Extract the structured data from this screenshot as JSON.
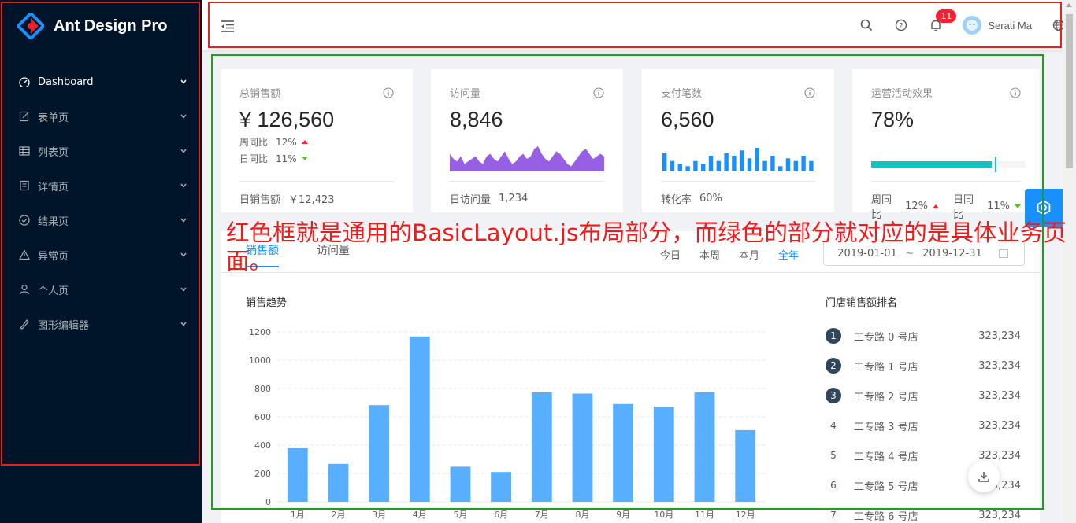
{
  "app": {
    "name": "Ant Design Pro"
  },
  "sidebar": {
    "items": [
      {
        "label": "Dashboard",
        "icon": "dashboard-icon",
        "active": true
      },
      {
        "label": "表单页",
        "icon": "form-icon"
      },
      {
        "label": "列表页",
        "icon": "table-icon"
      },
      {
        "label": "详情页",
        "icon": "profile-icon"
      },
      {
        "label": "结果页",
        "icon": "check-circle-icon"
      },
      {
        "label": "异常页",
        "icon": "warning-icon"
      },
      {
        "label": "个人页",
        "icon": "user-icon"
      },
      {
        "label": "图形编辑器",
        "icon": "highlight-icon"
      }
    ]
  },
  "header": {
    "notification_count": "11",
    "user_name": "Serati Ma"
  },
  "cards": {
    "sales": {
      "title": "总销售额",
      "value": "¥ 126,560",
      "week_label": "周同比",
      "week_value": "12%",
      "day_label": "日同比",
      "day_value": "11%",
      "footer_label": "日销售额",
      "footer_value": "￥12,423"
    },
    "visits": {
      "title": "访问量",
      "value": "8,846",
      "footer_label": "日访问量",
      "footer_value": "1,234"
    },
    "payments": {
      "title": "支付笔数",
      "value": "6,560",
      "footer_label": "转化率",
      "footer_value": "60%"
    },
    "operation": {
      "title": "运营活动效果",
      "value": "78%",
      "progress": 0.78,
      "target": 0.8,
      "week_label": "周同比",
      "week_value": "12%",
      "day_label": "日同比",
      "day_value": "11%"
    }
  },
  "sales_panel": {
    "tabs": [
      "销售额",
      "访问量"
    ],
    "ranges": [
      "今日",
      "本周",
      "本月",
      "全年"
    ],
    "date_start": "2019-01-01",
    "date_sep": "~",
    "date_end": "2019-12-31",
    "chart_title": "销售趋势",
    "rank_title": "门店销售额排名",
    "rank_items": [
      {
        "rank": "1",
        "name": "工专路 0 号店",
        "value": "323,234"
      },
      {
        "rank": "2",
        "name": "工专路 1 号店",
        "value": "323,234"
      },
      {
        "rank": "3",
        "name": "工专路 2 号店",
        "value": "323,234"
      },
      {
        "rank": "4",
        "name": "工专路 3 号店",
        "value": "323,234"
      },
      {
        "rank": "5",
        "name": "工专路 4 号店",
        "value": "323,234"
      },
      {
        "rank": "6",
        "name": "工专路 5 号店",
        "value": "323,234"
      },
      {
        "rank": "7",
        "name": "工专路 6 号店",
        "value": "323,234"
      }
    ]
  },
  "annotation": "红色框就是通用的BasicLayout.js布局部分，而绿色的部分就对应的是具体业务页面。",
  "colors": {
    "sidebar_bg": "#001529",
    "primary": "#1890ff",
    "red_box": "#e6231b",
    "green_box": "#1e9f1e",
    "bar": "#58afff",
    "area": "#975fe4",
    "progress": "#13c2c2"
  },
  "chart_data": {
    "type": "bar",
    "categories": [
      "1月",
      "2月",
      "3月",
      "4月",
      "5月",
      "6月",
      "7月",
      "8月",
      "9月",
      "10月",
      "11月",
      "12月"
    ],
    "values": [
      378,
      268,
      682,
      1168,
      248,
      210,
      772,
      764,
      690,
      672,
      774,
      506
    ],
    "ylim": [
      0,
      1200
    ],
    "yticks": [
      0,
      200,
      400,
      600,
      800,
      1000,
      1200
    ],
    "grid": true
  },
  "mini_charts": {
    "visits_area": [
      7,
      5,
      4,
      6,
      3,
      4,
      5,
      6,
      4,
      3,
      6,
      7,
      5,
      4,
      6,
      8,
      5,
      3,
      4,
      6,
      7,
      5,
      6,
      9,
      10,
      7,
      5,
      4,
      6,
      8,
      7,
      5,
      3,
      2,
      4,
      6,
      8,
      9,
      7,
      5,
      6,
      7,
      6
    ],
    "payments_bars": [
      7,
      4,
      3,
      2,
      4,
      3,
      6,
      4,
      7,
      6,
      8,
      5,
      9,
      4,
      6,
      2,
      5,
      4,
      6,
      4
    ]
  }
}
